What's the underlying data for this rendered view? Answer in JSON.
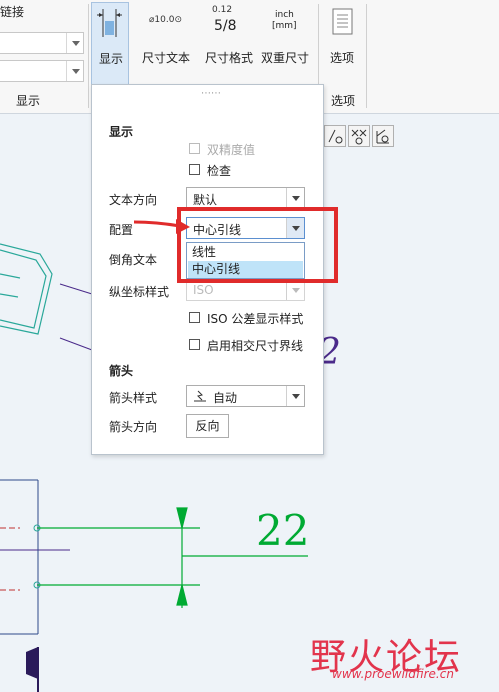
{
  "ribbon": {
    "left_group": {
      "fragment": "链接",
      "label": "显示"
    },
    "buttons": {
      "display": "显示",
      "dim_text": "尺寸文本",
      "dim_text_icon": "⌀10.0⊙",
      "dim_format": "尺寸格式",
      "dim_format_icon_top": "0.12",
      "dim_format_icon_bottom": "5/8",
      "dual_dim": "双重尺寸",
      "dual_dim_icon_top": "inch",
      "dual_dim_icon_bottom": "[mm]",
      "options": "选项"
    },
    "options_group_label": "选项"
  },
  "panel": {
    "grip": "⋯⋯",
    "display_heading": "显示",
    "dual_precision_label": "双精度值",
    "check_label": "检查",
    "text_direction": {
      "label": "文本方向",
      "value": "默认"
    },
    "config": {
      "label": "配置",
      "value": "中心引线",
      "options": [
        "线性",
        "中心引线"
      ]
    },
    "chamfer_text": {
      "label": "倒角文本"
    },
    "ordinate_style": {
      "label": "纵坐标样式",
      "value": "ISO"
    },
    "iso_tolerance_label": "ISO 公差显示样式",
    "intersect_extension_label": "启用相交尺寸界线",
    "arrow_heading": "箭头",
    "arrow_style": {
      "label": "箭头样式",
      "value": "自动"
    },
    "arrow_direction": {
      "label": "箭头方向",
      "button": "反向"
    }
  },
  "canvas": {
    "dimension_value_green": "22",
    "dimension_value_purple": "2"
  },
  "watermark": {
    "main": "野火论坛",
    "url": "www.proewildfire.cn"
  },
  "colors": {
    "annotation_red": "#e02b2b",
    "dimension_green": "#00aa33",
    "selected_item": "#bfe3f8",
    "part_teal": "#2aa89a",
    "sketch_purple": "#4a2a8a"
  }
}
